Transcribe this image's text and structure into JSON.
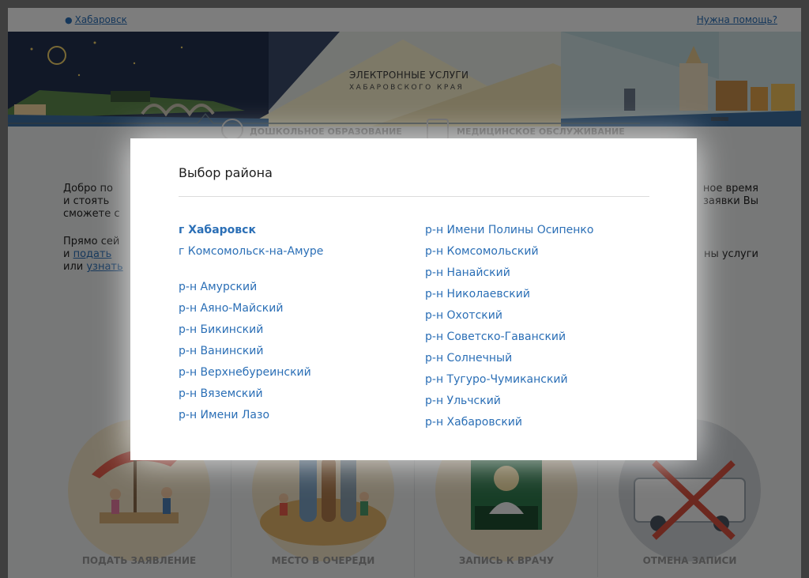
{
  "header": {
    "city": "Хабаровск",
    "help": "Нужна помощь?",
    "title_line1": "ЭЛЕКТРОННЫЕ УСЛУГИ",
    "title_line2": "ХАБАРОВСКОГО КРАЯ"
  },
  "nav": {
    "preschool": "ДОШКОЛЬНОЕ ОБРАЗОВАНИЕ",
    "medical": "МЕДИЦИНСКОЕ ОБСЛУЖИВАНИЕ"
  },
  "welcome": {
    "p1_line1_start": "Добро по",
    "p1_line2_start": "и стоять",
    "p1_line3_start": "сможете с",
    "p1_line1_end": "ное время",
    "p1_line2_end": "заявки Вы",
    "p2_line1_start": "Прямо сей",
    "p2_line2_start": "и",
    "p2_link1": "подать",
    "p2_line3_start": "или",
    "p2_link2": "узнать",
    "p2_line1_end": "ны  услуги"
  },
  "services": [
    {
      "label": "ПОДАТЬ ЗАЯВЛЕНИЕ"
    },
    {
      "label": "МЕСТО В ОЧЕРЕДИ"
    },
    {
      "label": "ЗАПИСЬ К ВРАЧУ"
    },
    {
      "label": "ОТМЕНА ЗАПИСИ"
    }
  ],
  "colors": {
    "link": "#2b6fb6",
    "circle_bg": "#f3e4c6"
  },
  "modal": {
    "title": "Выбор района",
    "cities": [
      "г Хабаровск",
      "г Комсомольск-на-Амуре"
    ],
    "selected_city": "г Хабаровск",
    "districts_left": [
      "р-н Амурский",
      "р-н Аяно-Майский",
      "р-н Бикинский",
      "р-н Ванинский",
      "р-н Верхнебуреинский",
      "р-н Вяземский",
      "р-н Имени Лазо"
    ],
    "districts_right": [
      "р-н Имени Полины Осипенко",
      "р-н Комсомольский",
      "р-н Нанайский",
      "р-н Николаевский",
      "р-н Охотский",
      "р-н Советско-Гаванский",
      "р-н Солнечный",
      "р-н Тугуро-Чумиканский",
      "р-н Ульчский",
      "р-н Хабаровский"
    ]
  }
}
